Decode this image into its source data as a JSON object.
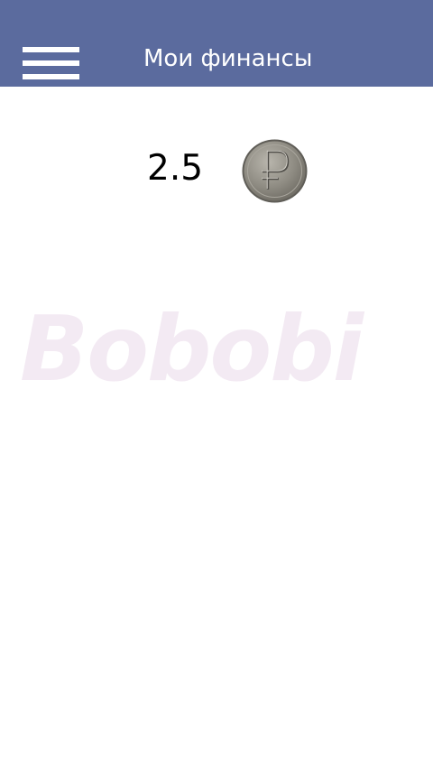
{
  "header": {
    "title": "Мои финансы",
    "menu_icon": "hamburger-menu-icon",
    "background_color": "#5b6b9e"
  },
  "balance": {
    "value": "2.5",
    "currency_icon": "ruble-coin-icon"
  },
  "watermark": {
    "text": "Bobobi"
  }
}
